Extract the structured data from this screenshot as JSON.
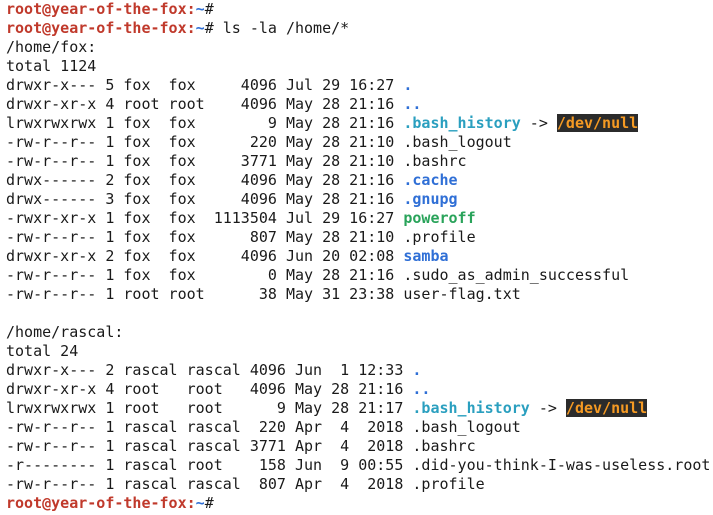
{
  "terminal": {
    "prompt": {
      "user_host": "root@year-of-the-fox",
      "sep": ":",
      "path": "~",
      "symbol": "#"
    },
    "command": "ls -la /home/*",
    "sections": [
      {
        "header": "/home/fox:",
        "total": "total 1124",
        "rows": [
          {
            "meta": "drwxr-x--- 5 fox  fox     4096 Jul 29 16:27 ",
            "name": ".",
            "kind": "dir"
          },
          {
            "meta": "drwxr-xr-x 4 root root    4096 May 28 21:16 ",
            "name": "..",
            "kind": "dir"
          },
          {
            "meta": "lrwxrwxrwx 1 fox  fox        9 May 28 21:16 ",
            "name": ".bash_history",
            "kind": "link",
            "arrow": " -> ",
            "target": "/dev/null"
          },
          {
            "meta": "-rw-r--r-- 1 fox  fox      220 May 28 21:10 ",
            "name": ".bash_logout",
            "kind": "file"
          },
          {
            "meta": "-rw-r--r-- 1 fox  fox     3771 May 28 21:10 ",
            "name": ".bashrc",
            "kind": "file"
          },
          {
            "meta": "drwx------ 2 fox  fox     4096 May 28 21:16 ",
            "name": ".cache",
            "kind": "dir"
          },
          {
            "meta": "drwx------ 3 fox  fox     4096 May 28 21:16 ",
            "name": ".gnupg",
            "kind": "dir"
          },
          {
            "meta": "-rwxr-xr-x 1 fox  fox  1113504 Jul 29 16:27 ",
            "name": "poweroff",
            "kind": "exec"
          },
          {
            "meta": "-rw-r--r-- 1 fox  fox      807 May 28 21:10 ",
            "name": ".profile",
            "kind": "file"
          },
          {
            "meta": "drwxr-xr-x 2 fox  fox     4096 Jun 20 02:08 ",
            "name": "samba",
            "kind": "dir"
          },
          {
            "meta": "-rw-r--r-- 1 fox  fox        0 May 28 21:16 ",
            "name": ".sudo_as_admin_successful",
            "kind": "file"
          },
          {
            "meta": "-rw-r--r-- 1 root root      38 May 31 23:38 ",
            "name": "user-flag.txt",
            "kind": "file"
          }
        ]
      },
      {
        "header": "/home/rascal:",
        "total": "total 24",
        "rows": [
          {
            "meta": "drwxr-x--- 2 rascal rascal 4096 Jun  1 12:33 ",
            "name": ".",
            "kind": "dir"
          },
          {
            "meta": "drwxr-xr-x 4 root   root   4096 May 28 21:16 ",
            "name": "..",
            "kind": "dir"
          },
          {
            "meta": "lrwxrwxrwx 1 root   root      9 May 28 21:17 ",
            "name": ".bash_history",
            "kind": "link",
            "arrow": " -> ",
            "target": "/dev/null"
          },
          {
            "meta": "-rw-r--r-- 1 rascal rascal  220 Apr  4  2018 ",
            "name": ".bash_logout",
            "kind": "file"
          },
          {
            "meta": "-rw-r--r-- 1 rascal rascal 3771 Apr  4  2018 ",
            "name": ".bashrc",
            "kind": "file"
          },
          {
            "meta": "-r-------- 1 rascal root    158 Jun  9 00:55 ",
            "name": ".did-you-think-I-was-useless.root",
            "kind": "file"
          },
          {
            "meta": "-rw-r--r-- 1 rascal rascal  807 Apr  4  2018 ",
            "name": ".profile",
            "kind": "file"
          }
        ]
      }
    ]
  }
}
